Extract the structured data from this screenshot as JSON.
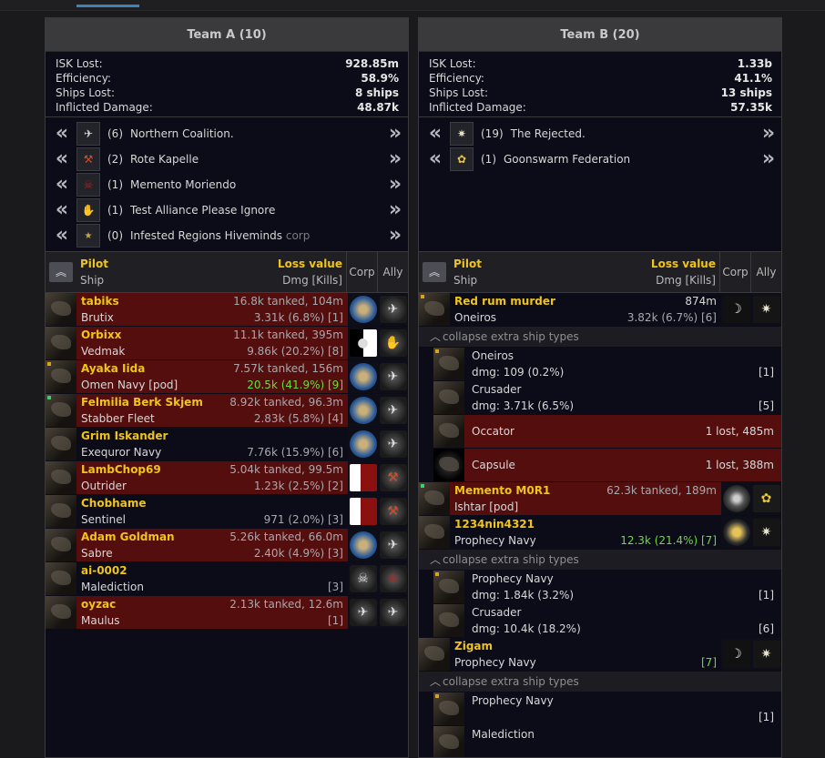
{
  "teams": [
    {
      "title": "Team A (10)",
      "stats": [
        {
          "label": "ISK Lost:",
          "value": "928.85m"
        },
        {
          "label": "Efficiency:",
          "value": "58.9%"
        },
        {
          "label": "Ships Lost:",
          "value": "8 ships"
        },
        {
          "label": "Inflicted Damage:",
          "value": "48.87k"
        }
      ],
      "alliances": [
        {
          "count": "(6)",
          "name": "Northern Coalition.",
          "sub": ""
        },
        {
          "count": "(2)",
          "name": "Rote Kapelle",
          "sub": ""
        },
        {
          "count": "(1)",
          "name": "Memento Moriendo",
          "sub": ""
        },
        {
          "count": "(1)",
          "name": "Test Alliance Please Ignore",
          "sub": ""
        },
        {
          "count": "(0)",
          "name": "Infested Regions Hiveminds",
          "sub": "corp"
        }
      ],
      "header": {
        "pilot": "Pilot",
        "loss": "Loss value",
        "ship": "Ship",
        "dmg": "Dmg [Kills]",
        "corp": "Corp",
        "ally": "Ally"
      },
      "pilots": [
        {
          "name": "tabiks",
          "ship": "Brutix",
          "top": "16.8k tanked, 104m",
          "bottom": "3.31k (6.8%) [1]",
          "lost": true
        },
        {
          "name": "Orbixx",
          "ship": "Vedmak",
          "top": "11.1k tanked, 395m",
          "bottom": "9.86k (20.2%) [8]",
          "lost": true
        },
        {
          "name": "Ayaka Iida",
          "ship": "Omen Navy [pod]",
          "top": "7.57k tanked, 156m",
          "bottom": "20.5k (41.9%) [9]",
          "lost": true
        },
        {
          "name": "Felmilia Berk Skjem",
          "ship": "Stabber Fleet",
          "top": "8.92k tanked, 96.3m",
          "bottom": "2.83k (5.8%) [4]",
          "lost": true
        },
        {
          "name": "Grim Iskander",
          "ship": "Exequror Navy",
          "top": "",
          "bottom": "7.76k (15.9%) [6]",
          "lost": false
        },
        {
          "name": "LambChop69",
          "ship": "Outrider",
          "top": "5.04k tanked, 99.5m",
          "bottom": "1.23k (2.5%) [2]",
          "lost": true
        },
        {
          "name": "Chobhame",
          "ship": "Sentinel",
          "top": "",
          "bottom": "971 (2.0%) [3]",
          "lost": false
        },
        {
          "name": "Adam Goldman",
          "ship": "Sabre",
          "top": "5.26k tanked, 66.0m",
          "bottom": "2.40k (4.9%) [3]",
          "lost": true
        },
        {
          "name": "ai-0002",
          "ship": "Malediction",
          "top": "",
          "bottom": "[3]",
          "lost": false
        },
        {
          "name": "oyzac",
          "ship": "Maulus",
          "top": "2.13k tanked, 12.6m",
          "bottom": "[1]",
          "lost": true
        }
      ]
    },
    {
      "title": "Team B (20)",
      "stats": [
        {
          "label": "ISK Lost:",
          "value": "1.33b"
        },
        {
          "label": "Efficiency:",
          "value": "41.1%"
        },
        {
          "label": "Ships Lost:",
          "value": "13 ships"
        },
        {
          "label": "Inflicted Damage:",
          "value": "57.35k"
        }
      ],
      "alliances": [
        {
          "count": "(19)",
          "name": "The Rejected.",
          "sub": ""
        },
        {
          "count": "(1)",
          "name": "Goonswarm Federation",
          "sub": ""
        }
      ],
      "header": {
        "pilot": "Pilot",
        "loss": "Loss value",
        "ship": "Ship",
        "dmg": "Dmg [Kills]",
        "corp": "Corp",
        "ally": "Ally"
      },
      "collapse_label": "collapse extra ship types",
      "pilots": [
        {
          "name": "Red rum murder",
          "ship": "Oneiros",
          "top": "874m",
          "bottom": "3.82k (6.7%) [6]",
          "lost": false
        },
        {
          "name": "Memento M0R1",
          "ship": "Ishtar [pod]",
          "top": "62.3k tanked, 189m",
          "bottom": "",
          "lost": true
        },
        {
          "name": "1234nin4321",
          "ship": "Prophecy Navy",
          "top": "",
          "bottom": "12.3k (21.4%) [7]",
          "lost": false
        },
        {
          "name": "Zigam",
          "ship": "Prophecy Navy",
          "top": "",
          "bottom": "[7]",
          "lost": false
        }
      ],
      "subships": {
        "red_rum": [
          {
            "ship": "Oneiros",
            "dmg": "dmg: 109 (0.2%)",
            "right": "[1]"
          },
          {
            "ship": "Crusader",
            "dmg": "dmg: 3.71k (6.5%)",
            "right": "[5]"
          },
          {
            "ship": "Occator",
            "right": "1 lost, 485m"
          },
          {
            "ship": "Capsule",
            "right": "1 lost, 388m"
          }
        ],
        "nin": [
          {
            "ship": "Prophecy Navy",
            "dmg": "dmg: 1.84k (3.2%)",
            "right": "[1]"
          },
          {
            "ship": "Crusader",
            "dmg": "dmg: 10.4k (18.2%)",
            "right": "[6]"
          }
        ],
        "zigam": [
          {
            "ship": "Prophecy Navy",
            "dmg": "",
            "right": "[1]"
          },
          {
            "ship": "Malediction",
            "dmg": "",
            "right": ""
          }
        ]
      }
    }
  ],
  "icons": {
    "chev_left": "double-chevron-left-icon",
    "chev_right": "double-chevron-right-icon",
    "sort": "double-chevron-up-icon",
    "collapse": "chevron-up-icon"
  },
  "colors": {
    "loss_row": "#540e0e",
    "gold": "#f0c419",
    "green": "#6ddc3b"
  }
}
